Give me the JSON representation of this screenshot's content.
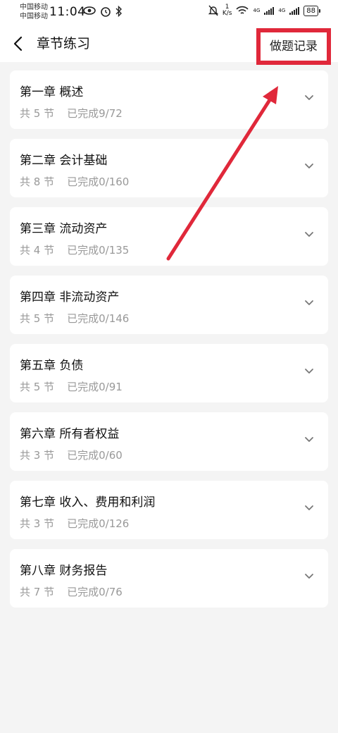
{
  "status_bar": {
    "carrier_1": "中国移动",
    "carrier_2": "中国移动",
    "time": "11:04",
    "net_speed_value": "1",
    "net_speed_unit": "K/s",
    "network_1": "4G",
    "network_2": "4G",
    "battery": "88"
  },
  "header": {
    "title": "章节练习",
    "record_label": "做题记录"
  },
  "chapters": [
    {
      "title": "第一章 概述",
      "sections": "共 5 节",
      "progress": "已完成9/72"
    },
    {
      "title": "第二章 会计基础",
      "sections": "共 8 节",
      "progress": "已完成0/160"
    },
    {
      "title": "第三章 流动资产",
      "sections": "共 4 节",
      "progress": "已完成0/135"
    },
    {
      "title": "第四章 非流动资产",
      "sections": "共 5 节",
      "progress": "已完成0/146"
    },
    {
      "title": "第五章 负债",
      "sections": "共 5 节",
      "progress": "已完成0/91"
    },
    {
      "title": "第六章 所有者权益",
      "sections": "共 3 节",
      "progress": "已完成0/60"
    },
    {
      "title": "第七章 收入、费用和利润",
      "sections": "共 3 节",
      "progress": "已完成0/126"
    },
    {
      "title": "第八章 财务报告",
      "sections": "共 7 节",
      "progress": "已完成0/76"
    }
  ],
  "colors": {
    "annotation": "#e0283a",
    "background": "#f4f4f4",
    "card": "#ffffff",
    "meta_text": "#999999"
  }
}
